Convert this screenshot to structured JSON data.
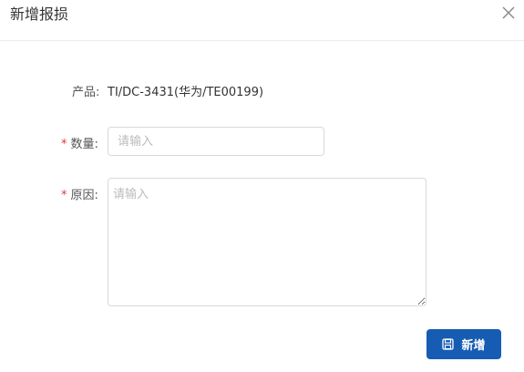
{
  "dialog": {
    "title": "新增报损",
    "close_icon": "close-icon"
  },
  "form": {
    "product": {
      "label": "产品:",
      "value": "TI/DC-3431(华为/TE00199)"
    },
    "quantity": {
      "required_mark": "*",
      "label": "数量:",
      "placeholder": "请输入",
      "value": ""
    },
    "reason": {
      "required_mark": "*",
      "label": "原因:",
      "placeholder": "请输入",
      "value": ""
    }
  },
  "footer": {
    "submit_label": "新增",
    "submit_icon": "save-icon",
    "submit_color": "#175cb3"
  }
}
